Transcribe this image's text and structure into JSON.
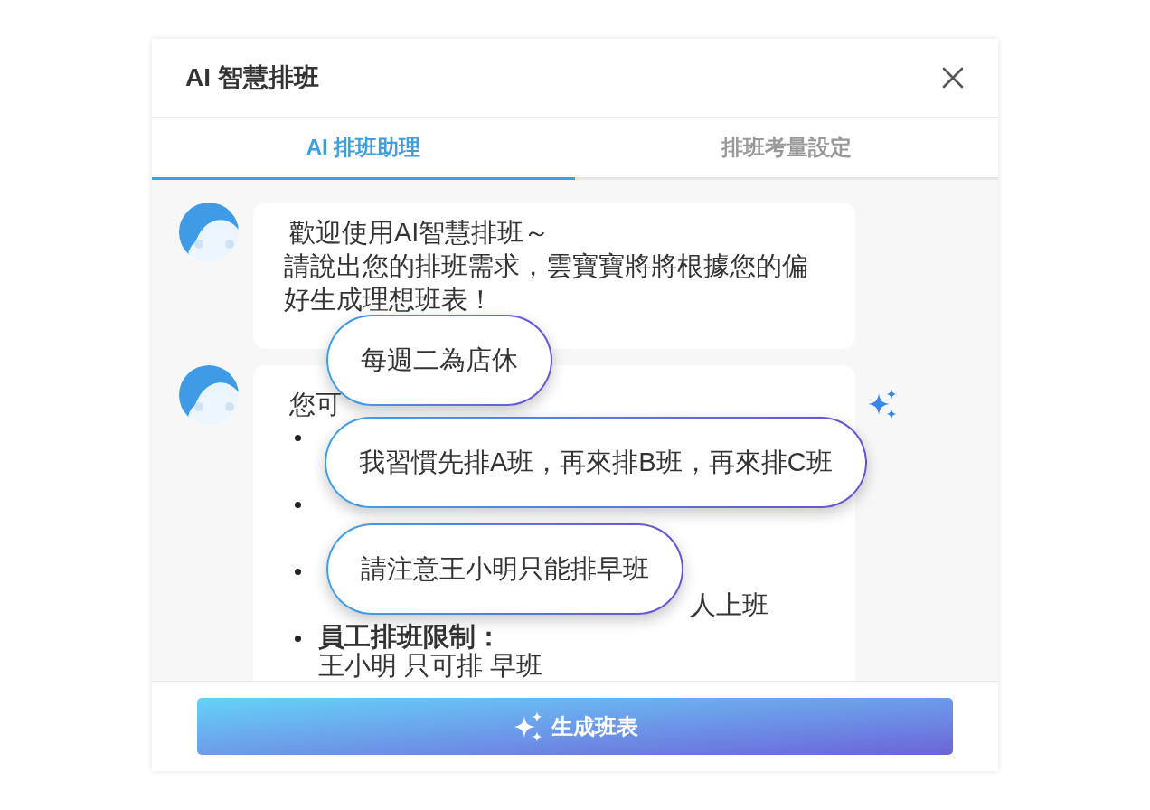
{
  "dialog": {
    "title": "AI 智慧排班"
  },
  "tabs": [
    {
      "label": "AI 排班助理",
      "selected": true
    },
    {
      "label": "排班考量設定",
      "selected": false
    }
  ],
  "messages": [
    {
      "lines": [
        "歡迎使用AI智慧排班～",
        "請說出您的排班需求，雲寶寶將將根據您的偏好生成理想班表！"
      ]
    },
    {
      "lines": [
        "您可"
      ],
      "items": [
        {
          "body": "人上班"
        },
        {
          "heading": "員工排班限制：",
          "body": "王小明 只可排 早班"
        }
      ]
    }
  ],
  "suggestions": [
    {
      "text": "每週二為店休"
    },
    {
      "text": "我習慣先排A班，再來排B班，再來排C班"
    },
    {
      "text": "請注意王小明只能排早班"
    }
  ],
  "generate_button": {
    "label": "生成班表"
  }
}
